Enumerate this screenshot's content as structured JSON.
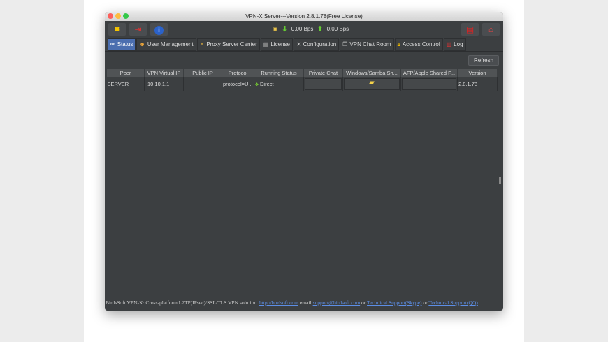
{
  "window": {
    "title": "VPN-X Server---Version 2.8.1.78(Free License)"
  },
  "toolbar": {
    "download_speed": "0.00 Bps",
    "upload_speed": "0.00 Bps",
    "icons": [
      "collapse-icon",
      "exit-icon",
      "info-icon",
      "network-icon",
      "download-icon",
      "upload-icon",
      "calendar-icon",
      "home-icon"
    ]
  },
  "tabs": [
    {
      "label": "Status",
      "icon": "status-icon"
    },
    {
      "label": "User Management",
      "icon": "users-icon"
    },
    {
      "label": "Proxy Server Center",
      "icon": "proxy-icon"
    },
    {
      "label": "License",
      "icon": "license-icon"
    },
    {
      "label": "Configuration",
      "icon": "tools-icon"
    },
    {
      "label": "VPN Chat Room",
      "icon": "chat-icon"
    },
    {
      "label": "Access Control",
      "icon": "lock-icon"
    },
    {
      "label": "Log",
      "icon": "log-icon"
    }
  ],
  "status": {
    "refresh_label": "Refresh",
    "columns": [
      "Peer",
      "VPN Virtual IP",
      "Public IP",
      "Protocol",
      "Running Status",
      "Private Chat",
      "Windows/Samba Sh...",
      "AFP/Apple Shared F...",
      "Version"
    ],
    "rows": [
      {
        "peer": "SERVER",
        "vip": "10.10.1.1",
        "public_ip": "",
        "protocol": "protocol=U...",
        "running_status": "Direct",
        "version": "2.8.1.78"
      }
    ]
  },
  "footer": {
    "text1": "BirdsSoft VPN-X: Cross-platform L2TP(IPsec)/SSL/TLS VPN solution.",
    "link1": "http://birdsoft.com",
    "text2": "email:",
    "link2": "support@birdsoft.com",
    "text3": "or",
    "link3": "Technical Support(Skype)",
    "text4": "or",
    "link4": "Technical Support(QQ)"
  }
}
